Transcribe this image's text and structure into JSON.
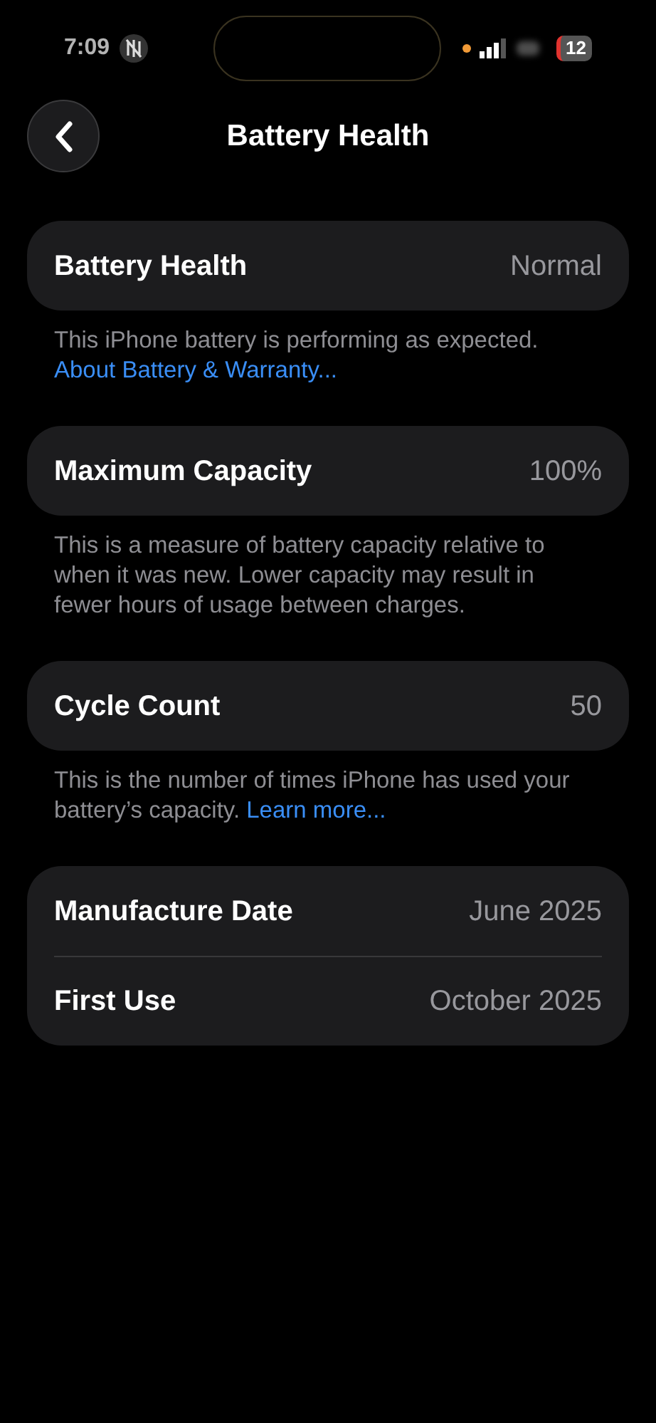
{
  "status_bar": {
    "time": "7:09",
    "battery": "12"
  },
  "nav": {
    "title": "Battery Health"
  },
  "sections": [
    {
      "rows": [
        {
          "label": "Battery Health",
          "value": "Normal"
        }
      ],
      "footer": "This iPhone battery is performing as expected.",
      "footer_link": "About Battery & Warranty..."
    },
    {
      "rows": [
        {
          "label": "Maximum Capacity",
          "value": "100%"
        }
      ],
      "footer": "This is a measure of battery capacity relative to when it was new. Lower capacity may result in fewer hours of usage between charges."
    },
    {
      "rows": [
        {
          "label": "Cycle Count",
          "value": "50"
        }
      ],
      "footer": "This is the number of times iPhone has used your battery’s capacity.",
      "footer_link": "Learn more..."
    },
    {
      "rows": [
        {
          "label": "Manufacture Date",
          "value": "June 2025"
        },
        {
          "label": "First Use",
          "value": "October 2025"
        }
      ]
    }
  ]
}
